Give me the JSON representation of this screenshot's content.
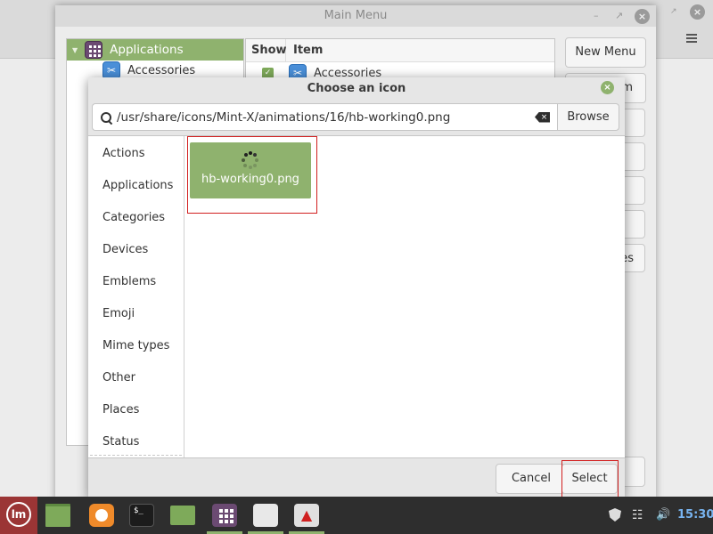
{
  "background_app": {
    "hamburger_icon": "hamburger-menu-icon",
    "close_icon": "close-icon"
  },
  "main_menu": {
    "title": "Main Menu",
    "tree": {
      "items": [
        {
          "label": "Applications",
          "icon": "applications-grid-icon",
          "selected": true,
          "expanded": true
        },
        {
          "label": "Accessories",
          "icon": "accessories-icon"
        }
      ]
    },
    "list": {
      "columns": [
        "Show",
        "Item"
      ],
      "rows": [
        {
          "show": true,
          "label": "Accessories",
          "icon": "accessories-icon"
        }
      ]
    },
    "buttons": {
      "new_menu": "New Menu",
      "new_item_partial": "m",
      "partial_bottom": "es"
    }
  },
  "dialog": {
    "title": "Choose an icon",
    "path_value": "/usr/share/icons/Mint-X/animations/16/hb-working0.png",
    "browse_label": "Browse",
    "categories": [
      "Actions",
      "Applications",
      "Categories",
      "Devices",
      "Emblems",
      "Emoji",
      "Mime types",
      "Other",
      "Places",
      "Status"
    ],
    "icons": [
      {
        "label": "hb-working0.png",
        "selected": true,
        "icon": "spinner-icon"
      }
    ],
    "cancel_label": "Cancel",
    "select_label": "Select",
    "accent_color": "#8fb26e"
  },
  "taskbar": {
    "launchers": [
      {
        "name": "show-desktop",
        "icon": "desktop-icon"
      },
      {
        "name": "firefox",
        "icon": "firefox-icon"
      },
      {
        "name": "terminal",
        "icon": "terminal-icon"
      },
      {
        "name": "files",
        "icon": "folder-icon"
      },
      {
        "name": "menu-editor",
        "icon": "applications-grid-icon",
        "running": true
      },
      {
        "name": "text-list",
        "icon": "list-icon",
        "running": true
      },
      {
        "name": "rocket",
        "icon": "rocket-icon",
        "running": true
      }
    ],
    "terminal_glyph": "$_",
    "clock": "15:30"
  }
}
